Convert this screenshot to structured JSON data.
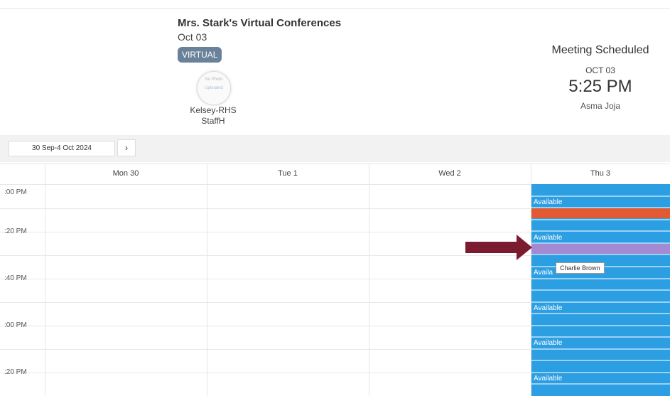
{
  "header": {
    "title": "Mrs. Stark's Virtual Conferences",
    "date": "Oct 03",
    "badge": "VIRTUAL",
    "avatar_text_1": "No Photo",
    "avatar_text_2": "Uploaded",
    "staff_name_1": "Kelsey-RHS",
    "staff_name_2": "StaffH"
  },
  "meeting": {
    "status": "Meeting Scheduled",
    "date": "OCT 03",
    "time": "5:25 PM",
    "person": "Asma Joja"
  },
  "toolbar": {
    "date_range": "30 Sep-4 Oct 2024",
    "next_label": "›"
  },
  "calendar": {
    "days": [
      "Mon 30",
      "Tue 1",
      "Wed 2",
      "Thu 3"
    ],
    "times": [
      ":00 PM",
      ":20 PM",
      ":40 PM",
      ":00 PM",
      ":20 PM"
    ],
    "slots": [
      "Available",
      "Available",
      "Availa",
      "Available",
      "Available",
      "Available"
    ],
    "tooltip": "Charlie Brown",
    "colors": {
      "available": "#2c9ee2",
      "booked_other": "#e25a34",
      "booked_selected": "#a48ad3",
      "annotation_arrow": "#7b1b30"
    }
  }
}
